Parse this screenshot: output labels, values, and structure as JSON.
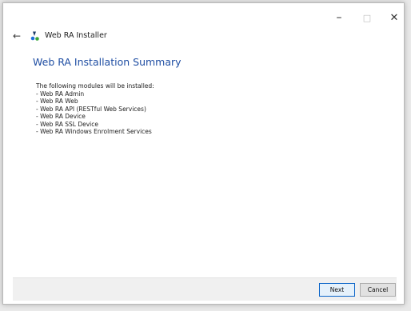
{
  "window": {
    "title": "Web RA Installer",
    "controls": {
      "minimize": "–",
      "maximize": "□",
      "close": "✕"
    },
    "back": "←"
  },
  "page": {
    "title": "Web RA Installation Summary",
    "intro": "The following modules will be installed:",
    "modules": [
      "- Web RA Admin",
      "- Web RA Web",
      "- Web RA API (RESTful Web Services)",
      "- Web RA Device",
      "- Web RA SSL Device",
      "- Web RA Windows Enrolment Services"
    ]
  },
  "footer": {
    "next_label": "Next",
    "cancel_label": "Cancel"
  },
  "colors": {
    "accent": "#1f4ea3",
    "logo_blue": "#1e6fd9",
    "logo_green": "#3aa63a",
    "logo_dark": "#1b3a66"
  },
  "icons": {
    "back": "arrow-left-icon",
    "app": "web-ra-logo-icon"
  }
}
